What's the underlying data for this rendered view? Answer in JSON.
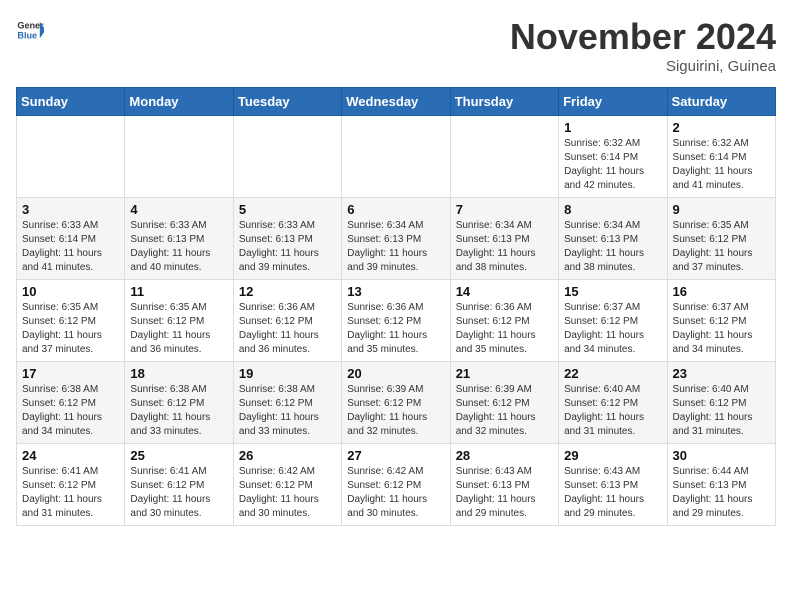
{
  "header": {
    "logo_general": "General",
    "logo_blue": "Blue",
    "month_title": "November 2024",
    "location": "Siguirini, Guinea"
  },
  "weekdays": [
    "Sunday",
    "Monday",
    "Tuesday",
    "Wednesday",
    "Thursday",
    "Friday",
    "Saturday"
  ],
  "weeks": [
    [
      {
        "day": "",
        "info": ""
      },
      {
        "day": "",
        "info": ""
      },
      {
        "day": "",
        "info": ""
      },
      {
        "day": "",
        "info": ""
      },
      {
        "day": "",
        "info": ""
      },
      {
        "day": "1",
        "info": "Sunrise: 6:32 AM\nSunset: 6:14 PM\nDaylight: 11 hours and 42 minutes."
      },
      {
        "day": "2",
        "info": "Sunrise: 6:32 AM\nSunset: 6:14 PM\nDaylight: 11 hours and 41 minutes."
      }
    ],
    [
      {
        "day": "3",
        "info": "Sunrise: 6:33 AM\nSunset: 6:14 PM\nDaylight: 11 hours and 41 minutes."
      },
      {
        "day": "4",
        "info": "Sunrise: 6:33 AM\nSunset: 6:13 PM\nDaylight: 11 hours and 40 minutes."
      },
      {
        "day": "5",
        "info": "Sunrise: 6:33 AM\nSunset: 6:13 PM\nDaylight: 11 hours and 39 minutes."
      },
      {
        "day": "6",
        "info": "Sunrise: 6:34 AM\nSunset: 6:13 PM\nDaylight: 11 hours and 39 minutes."
      },
      {
        "day": "7",
        "info": "Sunrise: 6:34 AM\nSunset: 6:13 PM\nDaylight: 11 hours and 38 minutes."
      },
      {
        "day": "8",
        "info": "Sunrise: 6:34 AM\nSunset: 6:13 PM\nDaylight: 11 hours and 38 minutes."
      },
      {
        "day": "9",
        "info": "Sunrise: 6:35 AM\nSunset: 6:12 PM\nDaylight: 11 hours and 37 minutes."
      }
    ],
    [
      {
        "day": "10",
        "info": "Sunrise: 6:35 AM\nSunset: 6:12 PM\nDaylight: 11 hours and 37 minutes."
      },
      {
        "day": "11",
        "info": "Sunrise: 6:35 AM\nSunset: 6:12 PM\nDaylight: 11 hours and 36 minutes."
      },
      {
        "day": "12",
        "info": "Sunrise: 6:36 AM\nSunset: 6:12 PM\nDaylight: 11 hours and 36 minutes."
      },
      {
        "day": "13",
        "info": "Sunrise: 6:36 AM\nSunset: 6:12 PM\nDaylight: 11 hours and 35 minutes."
      },
      {
        "day": "14",
        "info": "Sunrise: 6:36 AM\nSunset: 6:12 PM\nDaylight: 11 hours and 35 minutes."
      },
      {
        "day": "15",
        "info": "Sunrise: 6:37 AM\nSunset: 6:12 PM\nDaylight: 11 hours and 34 minutes."
      },
      {
        "day": "16",
        "info": "Sunrise: 6:37 AM\nSunset: 6:12 PM\nDaylight: 11 hours and 34 minutes."
      }
    ],
    [
      {
        "day": "17",
        "info": "Sunrise: 6:38 AM\nSunset: 6:12 PM\nDaylight: 11 hours and 34 minutes."
      },
      {
        "day": "18",
        "info": "Sunrise: 6:38 AM\nSunset: 6:12 PM\nDaylight: 11 hours and 33 minutes."
      },
      {
        "day": "19",
        "info": "Sunrise: 6:38 AM\nSunset: 6:12 PM\nDaylight: 11 hours and 33 minutes."
      },
      {
        "day": "20",
        "info": "Sunrise: 6:39 AM\nSunset: 6:12 PM\nDaylight: 11 hours and 32 minutes."
      },
      {
        "day": "21",
        "info": "Sunrise: 6:39 AM\nSunset: 6:12 PM\nDaylight: 11 hours and 32 minutes."
      },
      {
        "day": "22",
        "info": "Sunrise: 6:40 AM\nSunset: 6:12 PM\nDaylight: 11 hours and 31 minutes."
      },
      {
        "day": "23",
        "info": "Sunrise: 6:40 AM\nSunset: 6:12 PM\nDaylight: 11 hours and 31 minutes."
      }
    ],
    [
      {
        "day": "24",
        "info": "Sunrise: 6:41 AM\nSunset: 6:12 PM\nDaylight: 11 hours and 31 minutes."
      },
      {
        "day": "25",
        "info": "Sunrise: 6:41 AM\nSunset: 6:12 PM\nDaylight: 11 hours and 30 minutes."
      },
      {
        "day": "26",
        "info": "Sunrise: 6:42 AM\nSunset: 6:12 PM\nDaylight: 11 hours and 30 minutes."
      },
      {
        "day": "27",
        "info": "Sunrise: 6:42 AM\nSunset: 6:12 PM\nDaylight: 11 hours and 30 minutes."
      },
      {
        "day": "28",
        "info": "Sunrise: 6:43 AM\nSunset: 6:13 PM\nDaylight: 11 hours and 29 minutes."
      },
      {
        "day": "29",
        "info": "Sunrise: 6:43 AM\nSunset: 6:13 PM\nDaylight: 11 hours and 29 minutes."
      },
      {
        "day": "30",
        "info": "Sunrise: 6:44 AM\nSunset: 6:13 PM\nDaylight: 11 hours and 29 minutes."
      }
    ]
  ]
}
